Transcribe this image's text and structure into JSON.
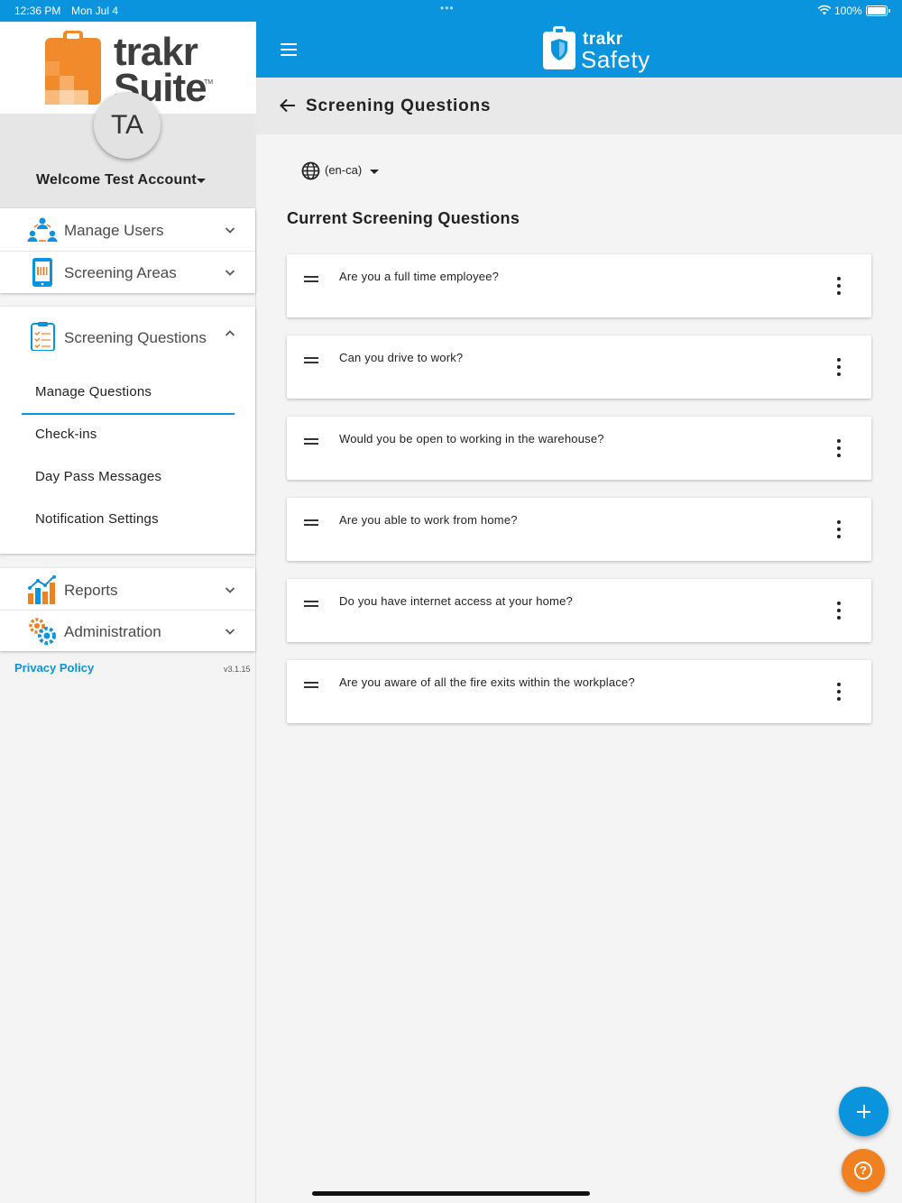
{
  "status_bar": {
    "time": "12:36 PM",
    "date": "Mon Jul 4",
    "battery": "100%"
  },
  "sidebar": {
    "logo_text": "trakr Suite",
    "logo_tm": "TM",
    "avatar_initials": "TA",
    "welcome": "Welcome Test Account",
    "nav": {
      "manage_users": "Manage Users",
      "screening_areas": "Screening Areas",
      "screening_questions": "Screening Questions",
      "reports": "Reports",
      "administration": "Administration"
    },
    "sub_items": [
      "Manage Questions",
      "Check-ins",
      "Day Pass Messages",
      "Notification Settings"
    ],
    "active_sub_item": "Manage Questions",
    "privacy_policy": "Privacy Policy",
    "version": "v3.1.15"
  },
  "header": {
    "brand_small": "trakr",
    "brand_large": "Safety"
  },
  "page": {
    "title": "Screening Questions",
    "language": "(en-ca)",
    "section_title": "Current Screening Questions",
    "questions": [
      "Are you a full time employee?",
      "Can you drive to work?",
      "Would you be open to working in the warehouse?",
      "Are you able to work from home?",
      "Do you have internet access at your home?",
      "Are you aware of all the fire exits within the workplace?"
    ]
  },
  "colors": {
    "primary_blue": "#0a94dd",
    "accent_orange": "#f08020",
    "sidebar_bg": "#f4f4f4"
  },
  "icons": {
    "menu": "hamburger-icon",
    "back": "arrow-back-icon",
    "language": "globe-icon",
    "add": "plus-icon",
    "help": "help-icon",
    "drag": "drag-handle-icon",
    "more": "more-vertical-icon"
  }
}
